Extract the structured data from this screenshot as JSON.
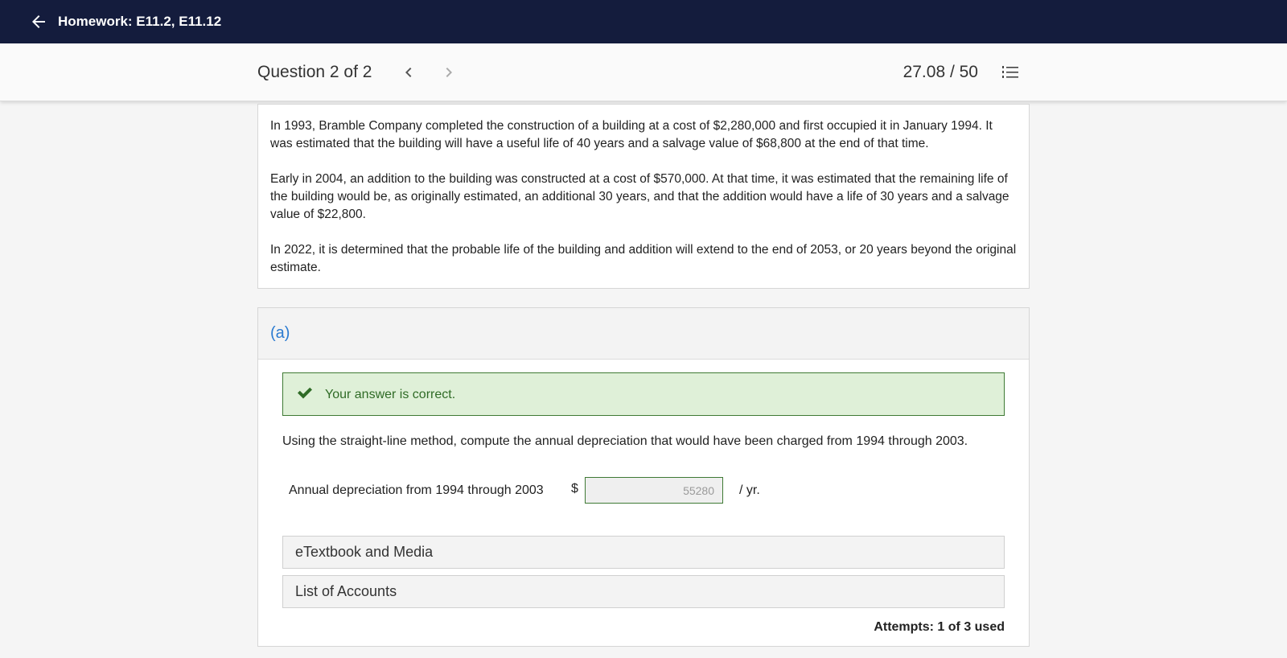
{
  "header": {
    "title": "Homework: E11.2, E11.12",
    "back_icon": "arrow-left-icon"
  },
  "subheader": {
    "question_label": "Question 2 of 2",
    "score": "27.08 / 50",
    "prev_icon": "chevron-left-icon",
    "next_icon": "chevron-right-icon",
    "list_icon": "numbered-list-icon"
  },
  "problem": {
    "paragraphs": [
      "In 1993, Bramble Company completed the construction of a building at a cost of $2,280,000 and first occupied it in January 1994. It was estimated that the building will have a useful life of 40 years and a salvage value of $68,800 at the end of that time.",
      "Early in 2004, an addition to the building was constructed at a cost of $570,000. At that time, it was estimated that the remaining life of the building would be, as originally estimated, an additional 30 years, and that the addition would have a life of 30 years and a salvage value of $22,800.",
      "In 2022, it is determined that the probable life of the building and addition will extend to the end of 2053, or 20 years beyond the original estimate."
    ]
  },
  "part_a": {
    "label": "(a)",
    "feedback": "Your answer is correct.",
    "feedback_color": "#dff0d8",
    "instruction": "Using the straight-line method, compute the annual depreciation that would have been charged from 1994 through 2003.",
    "answer_label": "Annual depreciation from 1994 through 2003",
    "currency": "$",
    "answer_value": "55280",
    "unit": "/ yr.",
    "accordions": [
      "eTextbook and Media",
      "List of Accounts"
    ],
    "attempts": "Attempts: 1 of 3 used"
  },
  "colors": {
    "topbar": "#141c3d",
    "accent_link": "#2b7bd1",
    "success_border": "#3f7a34"
  }
}
